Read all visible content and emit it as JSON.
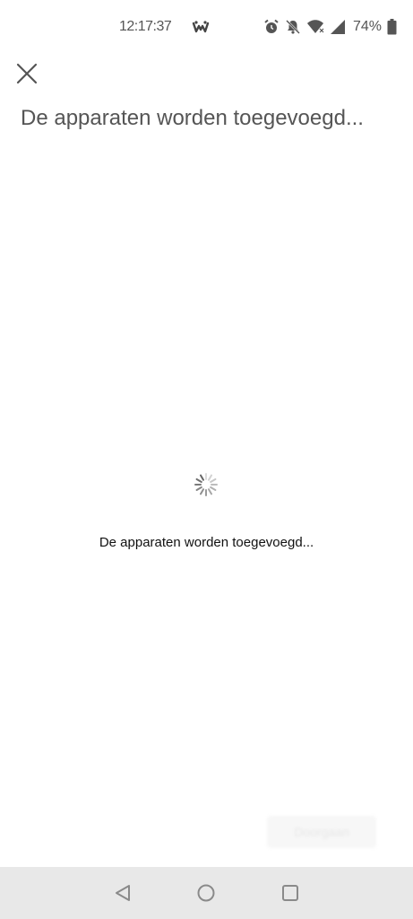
{
  "status_bar": {
    "time": "12:17:37",
    "battery": "74%",
    "icons": [
      "app-notification-icon",
      "alarm-icon",
      "bell-off-icon",
      "wifi-icon",
      "cell-signal-icon",
      "battery-icon"
    ]
  },
  "header": {
    "close_icon": "close-icon",
    "title": "De apparaten worden toegevoegd..."
  },
  "loading": {
    "spinner_icon": "loading-spinner-icon",
    "message": "De apparaten worden toegevoegd..."
  },
  "footer": {
    "faded_button_label": "Doorgaan"
  },
  "nav_bar": {
    "icons": [
      "back-icon",
      "home-icon",
      "recents-icon"
    ]
  },
  "colors": {
    "background": "#ffffff",
    "title_text": "#555555",
    "body_text": "#111111",
    "nav_background": "#e8e8e8"
  }
}
